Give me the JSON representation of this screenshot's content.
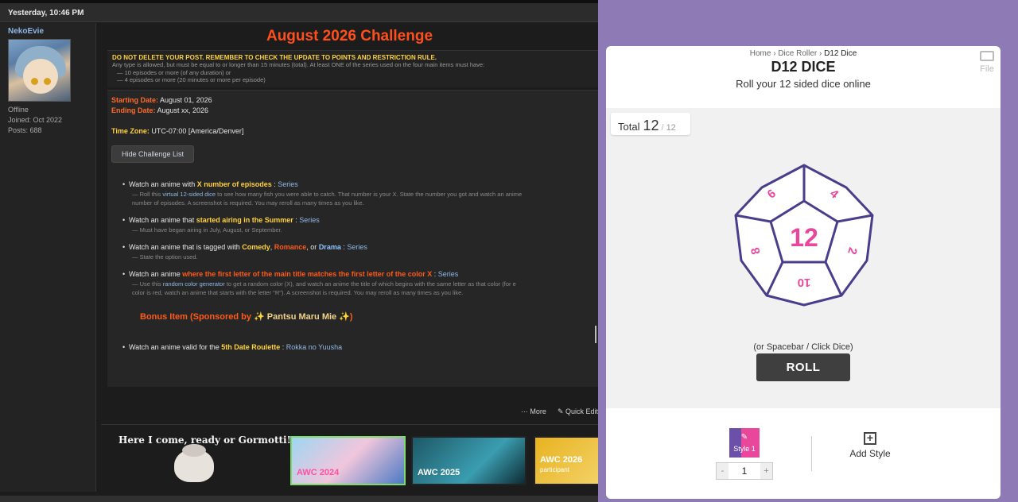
{
  "forum": {
    "datetime": "Yesterday, 10:46 PM",
    "user": {
      "name": "NekoEvie",
      "status": "Offline",
      "joined": "Joined: Oct 2022",
      "posts": "Posts: 688"
    },
    "challenge_title": "August 2026 Challenge",
    "notice_main": "DO NOT DELETE YOUR POST. REMEMBER TO CHECK THE UPDATE TO POINTS AND RESTRICTION RULE.",
    "notice_sub": "Any type is allowed, but must be equal to or longer than 15 minutes (total). At least ONE of the series used on the four main items must have:",
    "notice_rules": [
      "— 10 episodes or more (of any duration) or",
      "— 4 episodes or more (20 minutes or more per episode)"
    ],
    "starting_label": "Starting Date:",
    "starting_value": "August 01, 2026",
    "ending_label": "Ending Date:",
    "ending_value": "August xx, 2026",
    "timezone_label": "Time Zone:",
    "timezone_value": "UTC-07:00 [America/Denver]",
    "hide_button": "Hide Challenge List",
    "items": [
      {
        "pre": "Watch an anime with ",
        "hl": "X number of episodes",
        "post": " : ",
        "series": "Series",
        "sub1_pre": "— Roll this ",
        "sub1_link": "virtual 12-sided dice",
        "sub1_post": " to see how many fish you were able to catch. That number is your X. State the number you got and watch an anime",
        "sub2": "number of episodes. A screenshot is required. You may reroll as many times as you like."
      },
      {
        "pre": "Watch an anime that ",
        "hl": "started airing in the Summer",
        "post": " : ",
        "series": "Series",
        "sub1": "— Must have began airing in July, August, or September."
      },
      {
        "pre": "Watch an anime that is tagged with ",
        "g1": "Comedy",
        "g2": "Romance",
        "g3": "Drama",
        "series": "Series",
        "sub1": "— State the option used."
      },
      {
        "pre": "Watch an anime ",
        "hl": "where the first letter of the main title matches the first letter of the color X",
        "post": " : ",
        "series": "Series",
        "sub1_pre": "— Use this ",
        "sub1_link": "random color generator",
        "sub1_post": " to get a random color (X), and watch an anime the title of which begins with the same letter as that color (for e",
        "sub2": "color is red, watch an anime that starts with the letter \"R\"). A screenshot is required. You may reroll as many times as you like."
      }
    ],
    "bonus_label": "Bonus Item (Sponsored by ✨ ",
    "bonus_name": "Pantsu Maru Mie",
    "bonus_end": " ✨)",
    "bonus_item": {
      "pre": "Watch an anime valid for the ",
      "hl": "5th Date Roulette",
      "post": " : ",
      "series": "Rokka no Yuusha"
    },
    "actions": {
      "more": "··· More",
      "quick_edit": "✎ Quick Edit"
    },
    "signature_text": "Here I come, ready or Gormotti!",
    "banners": [
      "AWC 2024",
      "AWC 2025",
      "AWC 2026"
    ],
    "banner3_sub": "participant"
  },
  "dice": {
    "breadcrumbs": [
      "Home",
      "Dice Roller",
      "D12 Dice"
    ],
    "sep": "›",
    "title": "D12 DICE",
    "subtitle": "Roll your 12 sided dice online",
    "file_label": "File",
    "total_label": "Total",
    "total_value": "12",
    "total_max": "12",
    "total_sep": "/",
    "die_center": "12",
    "die_faces": [
      "6",
      "4",
      "8",
      "2",
      "10"
    ],
    "hint": "(or Spacebar / Click Dice)",
    "roll_label": "ROLL",
    "style_label": "Style 1",
    "count_value": "1",
    "minus": "-",
    "plus": "+",
    "add_style": "Add Style",
    "colors": {
      "pane_bg": "#8e7ab4",
      "die_stroke": "#4a3d8c",
      "die_text": "#e8479c",
      "roll_bg": "#3f3f3f"
    }
  }
}
